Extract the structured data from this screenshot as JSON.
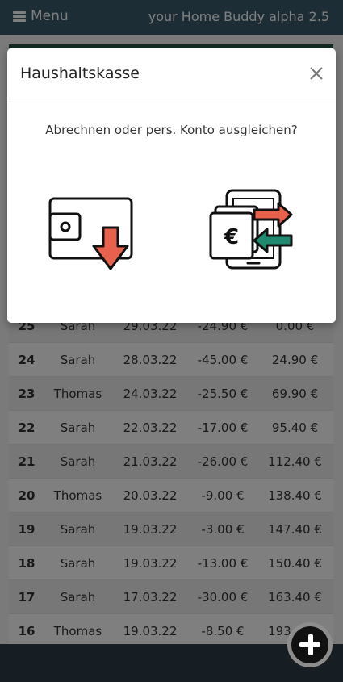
{
  "header": {
    "menu_label": "Menu",
    "app_title": "your Home Buddy alpha 2.5"
  },
  "table": {
    "rows": [
      {
        "id": "25",
        "name": "Sarah",
        "date": "29.03.22",
        "amount": "-24.90 €",
        "balance": "0.00 €"
      },
      {
        "id": "24",
        "name": "Sarah",
        "date": "28.03.22",
        "amount": "-45.00 €",
        "balance": "24.90 €"
      },
      {
        "id": "23",
        "name": "Thomas",
        "date": "24.03.22",
        "amount": "-25.50 €",
        "balance": "69.90 €"
      },
      {
        "id": "22",
        "name": "Sarah",
        "date": "22.03.22",
        "amount": "-17.00 €",
        "balance": "95.40 €"
      },
      {
        "id": "21",
        "name": "Sarah",
        "date": "21.03.22",
        "amount": "-26.00 €",
        "balance": "112.40 €"
      },
      {
        "id": "20",
        "name": "Thomas",
        "date": "20.03.22",
        "amount": "-9.00 €",
        "balance": "138.40 €"
      },
      {
        "id": "19",
        "name": "Sarah",
        "date": "19.03.22",
        "amount": "-3.00 €",
        "balance": "147.40 €"
      },
      {
        "id": "18",
        "name": "Sarah",
        "date": "19.03.22",
        "amount": "-13.00 €",
        "balance": "150.40 €"
      },
      {
        "id": "17",
        "name": "Sarah",
        "date": "17.03.22",
        "amount": "-30.00 €",
        "balance": "163.40 €"
      },
      {
        "id": "16",
        "name": "Thomas",
        "date": "19.03.22",
        "amount": "-8.50 €",
        "balance": "193.40 €"
      }
    ]
  },
  "modal": {
    "title": "Haushaltskasse",
    "question": "Abrechnen oder pers. Konto ausgleichen?",
    "options": [
      {
        "icon": "wallet-settle-icon"
      },
      {
        "icon": "phone-transfer-icon"
      }
    ]
  },
  "fab": {
    "icon": "plus-circle-icon"
  },
  "colors": {
    "header_bg": "#3b5b6b",
    "accent_red": "#e8614d",
    "accent_green": "#1f8a70",
    "bottom_bar": "#2e3d47"
  }
}
